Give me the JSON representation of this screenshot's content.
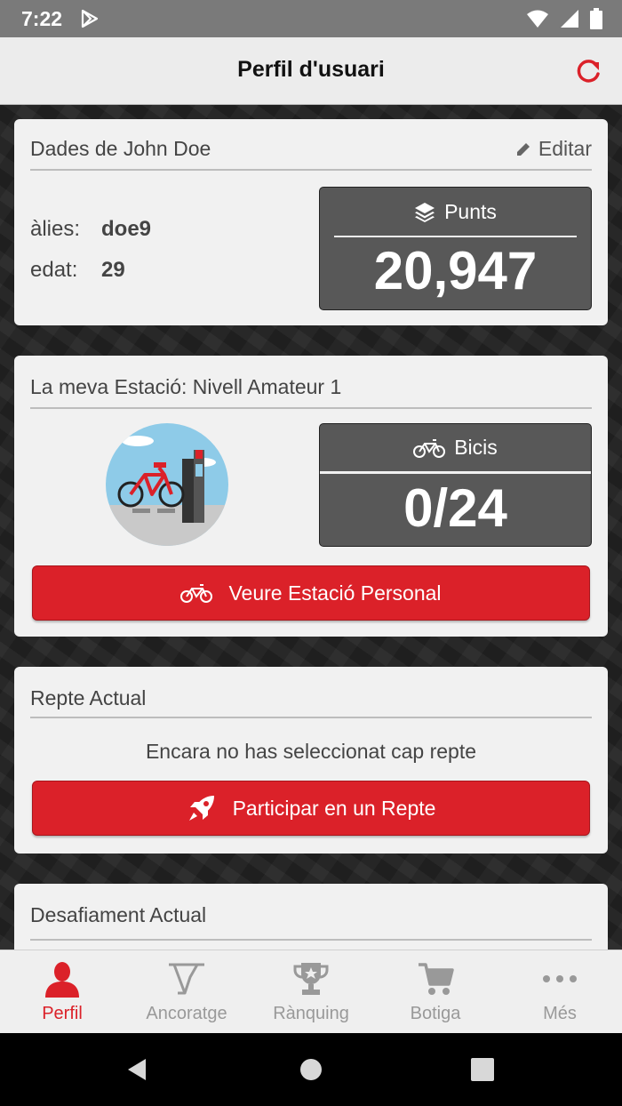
{
  "status_bar": {
    "time": "7:22"
  },
  "header": {
    "title": "Perfil d'usuari"
  },
  "user_card": {
    "heading": "Dades de John Doe",
    "edit_label": "Editar",
    "alias_label": "àlies:",
    "alias_value": "doe9",
    "age_label": "edat:",
    "age_value": "29",
    "points_label": "Punts",
    "points_value": "20,947"
  },
  "station_card": {
    "heading": "La meva Estació: Nivell Amateur 1",
    "bikes_label": "Bicis",
    "bikes_value": "0/24",
    "button_label": "Veure Estació Personal"
  },
  "challenge_card": {
    "heading": "Repte Actual",
    "message": "Encara no has seleccionat cap repte",
    "button_label": "Participar en un Repte"
  },
  "defiance_card": {
    "heading": "Desafiament Actual"
  },
  "bottom_nav": {
    "items": [
      {
        "label": "Perfil",
        "icon": "person-icon",
        "active": true
      },
      {
        "label": "Ancoratge",
        "icon": "dock-icon",
        "active": false
      },
      {
        "label": "Rànquing",
        "icon": "trophy-icon",
        "active": false
      },
      {
        "label": "Botiga",
        "icon": "cart-icon",
        "active": false
      },
      {
        "label": "Més",
        "icon": "more-icon",
        "active": false
      }
    ]
  },
  "colors": {
    "accent": "#db2129",
    "stat_box": "#585858",
    "card": "#f1f1f1"
  }
}
